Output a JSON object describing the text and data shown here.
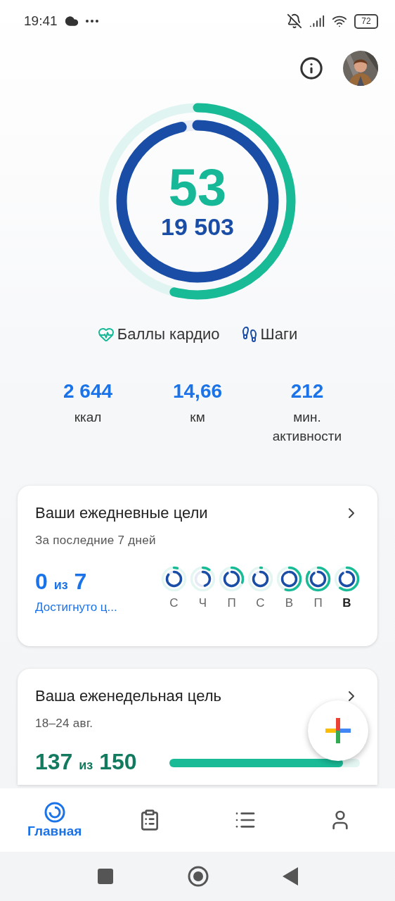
{
  "status_bar": {
    "time": "19:41",
    "battery": "72"
  },
  "rings": {
    "cardio_points": "53",
    "steps_count": "19 503"
  },
  "legend": [
    {
      "kind": "cardio",
      "label": "Баллы кардио"
    },
    {
      "kind": "steps",
      "label": "Шаги"
    }
  ],
  "stats": [
    {
      "value": "2 644",
      "label": "ккал"
    },
    {
      "value": "14,66",
      "label": "км"
    },
    {
      "value": "212",
      "label": "мин. активности"
    }
  ],
  "daily_goals": {
    "title": "Ваши ежедневные цели",
    "subtitle": "За последние 7 дней",
    "achieved": "0",
    "of": "из",
    "total": "7",
    "caption": "Достигнуто ц...",
    "days": [
      {
        "label": "С",
        "today": false
      },
      {
        "label": "Ч",
        "today": false
      },
      {
        "label": "П",
        "today": false
      },
      {
        "label": "С",
        "today": false
      },
      {
        "label": "В",
        "today": false
      },
      {
        "label": "П",
        "today": false
      },
      {
        "label": "В",
        "today": true
      }
    ]
  },
  "weekly_goal": {
    "title": "Ваша еженедельная цель",
    "subtitle": "18–24 авг.",
    "achieved": "137",
    "of": "из",
    "total": "150",
    "level": 0.913
  },
  "bottom_nav": [
    {
      "kind": "home",
      "label": "Главная",
      "selected": true
    },
    {
      "kind": "journal",
      "selected": false
    },
    {
      "kind": "browse",
      "selected": false
    },
    {
      "kind": "profile",
      "selected": false
    }
  ]
}
